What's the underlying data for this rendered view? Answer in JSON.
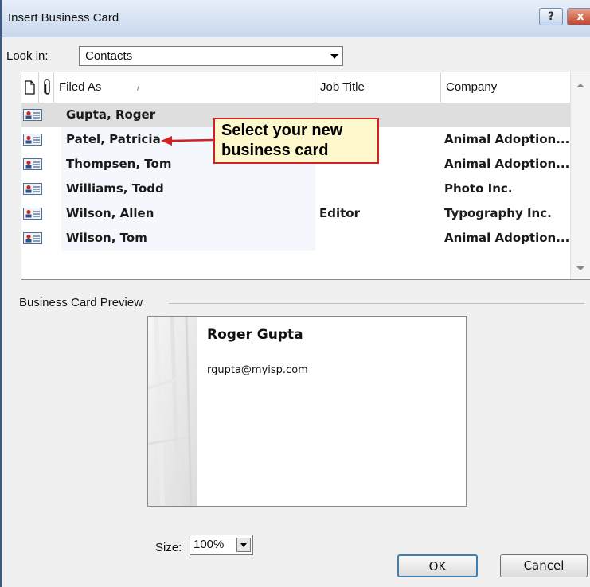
{
  "window": {
    "title": "Insert Business Card",
    "help_label": "?",
    "close_label": "x"
  },
  "look_in": {
    "label": "Look in:",
    "value": "Contacts"
  },
  "table": {
    "columns": [
      "Filed As",
      "Job Title",
      "Company"
    ],
    "sort_indicator": "/",
    "rows": [
      {
        "filed_as": "Gupta, Roger",
        "job_title": "",
        "company": "",
        "selected": true
      },
      {
        "filed_as": "Patel, Patricia",
        "job_title": "",
        "company": "Animal Adoption...",
        "selected": false
      },
      {
        "filed_as": "Thompsen, Tom",
        "job_title": "",
        "company": "Animal Adoption...",
        "selected": false
      },
      {
        "filed_as": "Williams, Todd",
        "job_title": "",
        "company": "Photo Inc.",
        "selected": false
      },
      {
        "filed_as": "Wilson, Allen",
        "job_title": "Editor",
        "company": "Typography Inc.",
        "selected": false
      },
      {
        "filed_as": "Wilson, Tom",
        "job_title": "",
        "company": "Animal Adoption...",
        "selected": false
      }
    ]
  },
  "callout": {
    "line1": "Select your new",
    "line2": "business card"
  },
  "preview": {
    "label": "Business Card Preview",
    "card_name": "Roger Gupta",
    "card_email": "rgupta@myisp.com"
  },
  "size": {
    "label": "Size:",
    "value": "100%"
  },
  "buttons": {
    "ok": "OK",
    "cancel": "Cancel"
  },
  "colors": {
    "selected_row": "#dedede",
    "callout_border": "#d32020",
    "callout_fill": "#fff8cc",
    "title_bar": "#c9d9ee"
  }
}
